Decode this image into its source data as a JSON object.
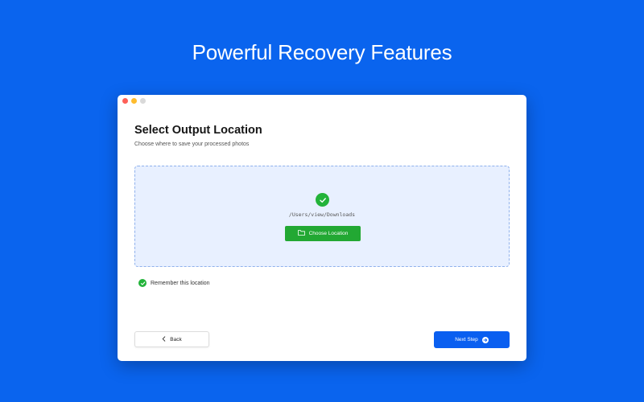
{
  "headline": "Powerful Recovery Features",
  "window": {
    "traffic_lights": [
      "close",
      "minimize",
      "zoom"
    ]
  },
  "page": {
    "title": "Select Output Location",
    "subtitle": "Choose where to save your processed photos"
  },
  "dropzone": {
    "status_icon": "check-circle-icon",
    "path": "/Users/view/Downloads",
    "choose_button": {
      "label": "Choose Location",
      "icon": "folder-icon"
    }
  },
  "remember": {
    "label": "Remember this location",
    "checked": true
  },
  "footer": {
    "back_label": "Back",
    "next_label": "Next Step"
  },
  "colors": {
    "background": "#0a64ee",
    "success": "#23b33a",
    "primary": "#0a5ff0",
    "dropzone_bg": "#e8f0ff"
  }
}
